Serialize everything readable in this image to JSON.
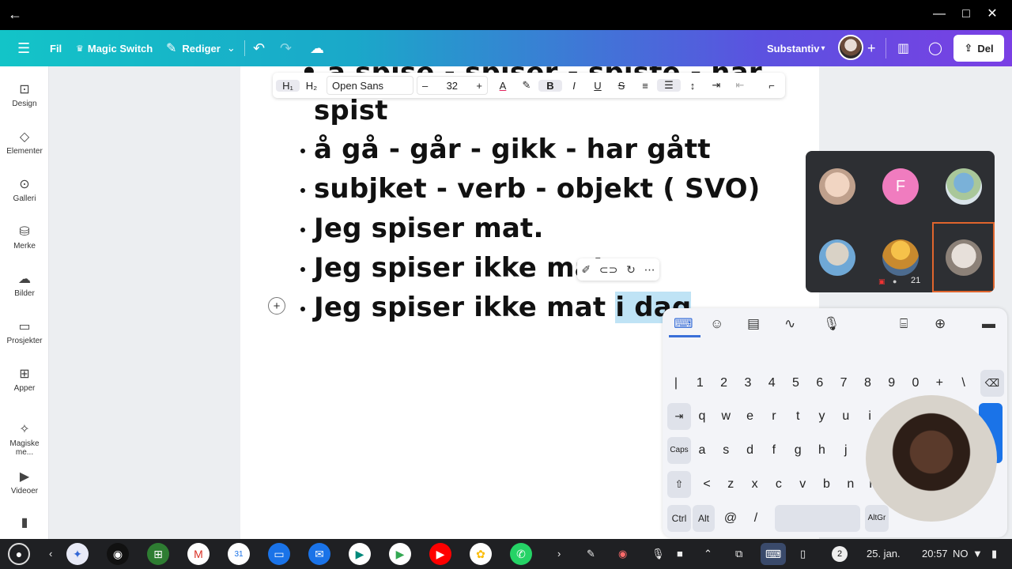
{
  "window": {
    "back": "←",
    "minimize": "—",
    "maximize": "□",
    "close": "✕"
  },
  "appbar": {
    "menu": "☰",
    "file": "Fil",
    "magic_switch": "Magic Switch",
    "edit": "Rediger",
    "substantiv": "Substantiv",
    "share": "Del"
  },
  "rail": [
    {
      "label": "Design",
      "icon": "⊡"
    },
    {
      "label": "Elementer",
      "icon": "◇"
    },
    {
      "label": "Galleri",
      "icon": "⊙"
    },
    {
      "label": "Merke",
      "icon": "⛁"
    },
    {
      "label": "Bilder",
      "icon": "☁"
    },
    {
      "label": "Prosjekter",
      "icon": "▭"
    },
    {
      "label": "Apper",
      "icon": "⊞"
    },
    {
      "label": "Magiske me...",
      "icon": "✧"
    },
    {
      "label": "Videoer",
      "icon": "▶"
    }
  ],
  "toolbar": {
    "h1": "H₁",
    "h2": "H₂",
    "font": "Open Sans",
    "minus": "–",
    "size": "32",
    "plus": "+",
    "text_color": "A",
    "bold": "B",
    "italic": "I",
    "underline": "U",
    "strike": "S"
  },
  "doc": {
    "partial_top": "• å spise - spiser - spiste - har",
    "line0": "spist",
    "line1": "å gå - går - gikk - har gått",
    "line2": " subjket - verb - objekt ( SVO)",
    "line3": "Jeg spiser mat.",
    "line4": "Jeg spiser ikke mat",
    "line5_a": "Jeg spiser ikke mat ",
    "line5_sel": "i dag",
    "line5_b": "."
  },
  "call": {
    "participant_initial": "F",
    "participant_count": "21"
  },
  "keyboard": {
    "row1": [
      "|",
      "1",
      "2",
      "3",
      "4",
      "5",
      "6",
      "7",
      "8",
      "9",
      "0",
      "+",
      "\\"
    ],
    "row1_sub": [
      "",
      "",
      "",
      "§",
      "",
      "",
      "%",
      "",
      "",
      "",
      "",
      "",
      ""
    ],
    "row2": [
      "q",
      "w",
      "e",
      "r",
      "t",
      "y",
      "u",
      "i"
    ],
    "row3": [
      "a",
      "s",
      "d",
      "f",
      "g",
      "h",
      "j",
      "k"
    ],
    "row4": [
      "<",
      "z",
      "x",
      "c",
      "v",
      "b",
      "n",
      "m"
    ],
    "caps": "Caps",
    "ctrl": "Ctrl",
    "alt": "Alt",
    "at": "@",
    "slash": "/",
    "altgr": "AltGr"
  },
  "shelf": {
    "date": "25. jan.",
    "time": "20:57",
    "lang": "NO",
    "badge": "2"
  }
}
